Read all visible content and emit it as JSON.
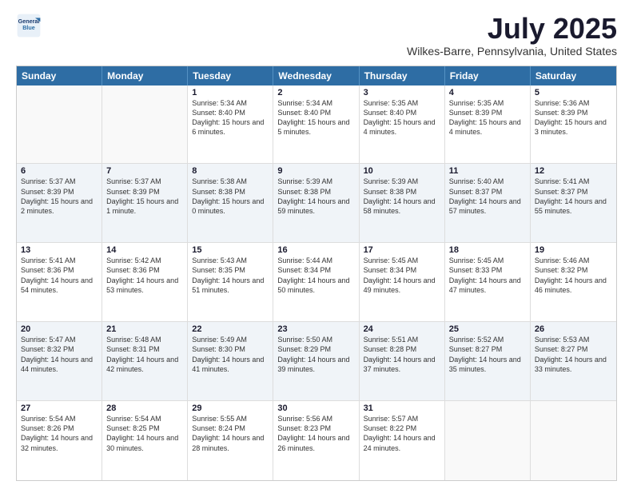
{
  "logo": {
    "line1": "General",
    "line2": "Blue"
  },
  "title": "July 2025",
  "location": "Wilkes-Barre, Pennsylvania, United States",
  "days": [
    "Sunday",
    "Monday",
    "Tuesday",
    "Wednesday",
    "Thursday",
    "Friday",
    "Saturday"
  ],
  "weeks": [
    [
      {
        "day": "",
        "info": ""
      },
      {
        "day": "",
        "info": ""
      },
      {
        "day": "1",
        "info": "Sunrise: 5:34 AM\nSunset: 8:40 PM\nDaylight: 15 hours and 6 minutes."
      },
      {
        "day": "2",
        "info": "Sunrise: 5:34 AM\nSunset: 8:40 PM\nDaylight: 15 hours and 5 minutes."
      },
      {
        "day": "3",
        "info": "Sunrise: 5:35 AM\nSunset: 8:40 PM\nDaylight: 15 hours and 4 minutes."
      },
      {
        "day": "4",
        "info": "Sunrise: 5:35 AM\nSunset: 8:39 PM\nDaylight: 15 hours and 4 minutes."
      },
      {
        "day": "5",
        "info": "Sunrise: 5:36 AM\nSunset: 8:39 PM\nDaylight: 15 hours and 3 minutes."
      }
    ],
    [
      {
        "day": "6",
        "info": "Sunrise: 5:37 AM\nSunset: 8:39 PM\nDaylight: 15 hours and 2 minutes."
      },
      {
        "day": "7",
        "info": "Sunrise: 5:37 AM\nSunset: 8:39 PM\nDaylight: 15 hours and 1 minute."
      },
      {
        "day": "8",
        "info": "Sunrise: 5:38 AM\nSunset: 8:38 PM\nDaylight: 15 hours and 0 minutes."
      },
      {
        "day": "9",
        "info": "Sunrise: 5:39 AM\nSunset: 8:38 PM\nDaylight: 14 hours and 59 minutes."
      },
      {
        "day": "10",
        "info": "Sunrise: 5:39 AM\nSunset: 8:38 PM\nDaylight: 14 hours and 58 minutes."
      },
      {
        "day": "11",
        "info": "Sunrise: 5:40 AM\nSunset: 8:37 PM\nDaylight: 14 hours and 57 minutes."
      },
      {
        "day": "12",
        "info": "Sunrise: 5:41 AM\nSunset: 8:37 PM\nDaylight: 14 hours and 55 minutes."
      }
    ],
    [
      {
        "day": "13",
        "info": "Sunrise: 5:41 AM\nSunset: 8:36 PM\nDaylight: 14 hours and 54 minutes."
      },
      {
        "day": "14",
        "info": "Sunrise: 5:42 AM\nSunset: 8:36 PM\nDaylight: 14 hours and 53 minutes."
      },
      {
        "day": "15",
        "info": "Sunrise: 5:43 AM\nSunset: 8:35 PM\nDaylight: 14 hours and 51 minutes."
      },
      {
        "day": "16",
        "info": "Sunrise: 5:44 AM\nSunset: 8:34 PM\nDaylight: 14 hours and 50 minutes."
      },
      {
        "day": "17",
        "info": "Sunrise: 5:45 AM\nSunset: 8:34 PM\nDaylight: 14 hours and 49 minutes."
      },
      {
        "day": "18",
        "info": "Sunrise: 5:45 AM\nSunset: 8:33 PM\nDaylight: 14 hours and 47 minutes."
      },
      {
        "day": "19",
        "info": "Sunrise: 5:46 AM\nSunset: 8:32 PM\nDaylight: 14 hours and 46 minutes."
      }
    ],
    [
      {
        "day": "20",
        "info": "Sunrise: 5:47 AM\nSunset: 8:32 PM\nDaylight: 14 hours and 44 minutes."
      },
      {
        "day": "21",
        "info": "Sunrise: 5:48 AM\nSunset: 8:31 PM\nDaylight: 14 hours and 42 minutes."
      },
      {
        "day": "22",
        "info": "Sunrise: 5:49 AM\nSunset: 8:30 PM\nDaylight: 14 hours and 41 minutes."
      },
      {
        "day": "23",
        "info": "Sunrise: 5:50 AM\nSunset: 8:29 PM\nDaylight: 14 hours and 39 minutes."
      },
      {
        "day": "24",
        "info": "Sunrise: 5:51 AM\nSunset: 8:28 PM\nDaylight: 14 hours and 37 minutes."
      },
      {
        "day": "25",
        "info": "Sunrise: 5:52 AM\nSunset: 8:27 PM\nDaylight: 14 hours and 35 minutes."
      },
      {
        "day": "26",
        "info": "Sunrise: 5:53 AM\nSunset: 8:27 PM\nDaylight: 14 hours and 33 minutes."
      }
    ],
    [
      {
        "day": "27",
        "info": "Sunrise: 5:54 AM\nSunset: 8:26 PM\nDaylight: 14 hours and 32 minutes."
      },
      {
        "day": "28",
        "info": "Sunrise: 5:54 AM\nSunset: 8:25 PM\nDaylight: 14 hours and 30 minutes."
      },
      {
        "day": "29",
        "info": "Sunrise: 5:55 AM\nSunset: 8:24 PM\nDaylight: 14 hours and 28 minutes."
      },
      {
        "day": "30",
        "info": "Sunrise: 5:56 AM\nSunset: 8:23 PM\nDaylight: 14 hours and 26 minutes."
      },
      {
        "day": "31",
        "info": "Sunrise: 5:57 AM\nSunset: 8:22 PM\nDaylight: 14 hours and 24 minutes."
      },
      {
        "day": "",
        "info": ""
      },
      {
        "day": "",
        "info": ""
      }
    ]
  ]
}
